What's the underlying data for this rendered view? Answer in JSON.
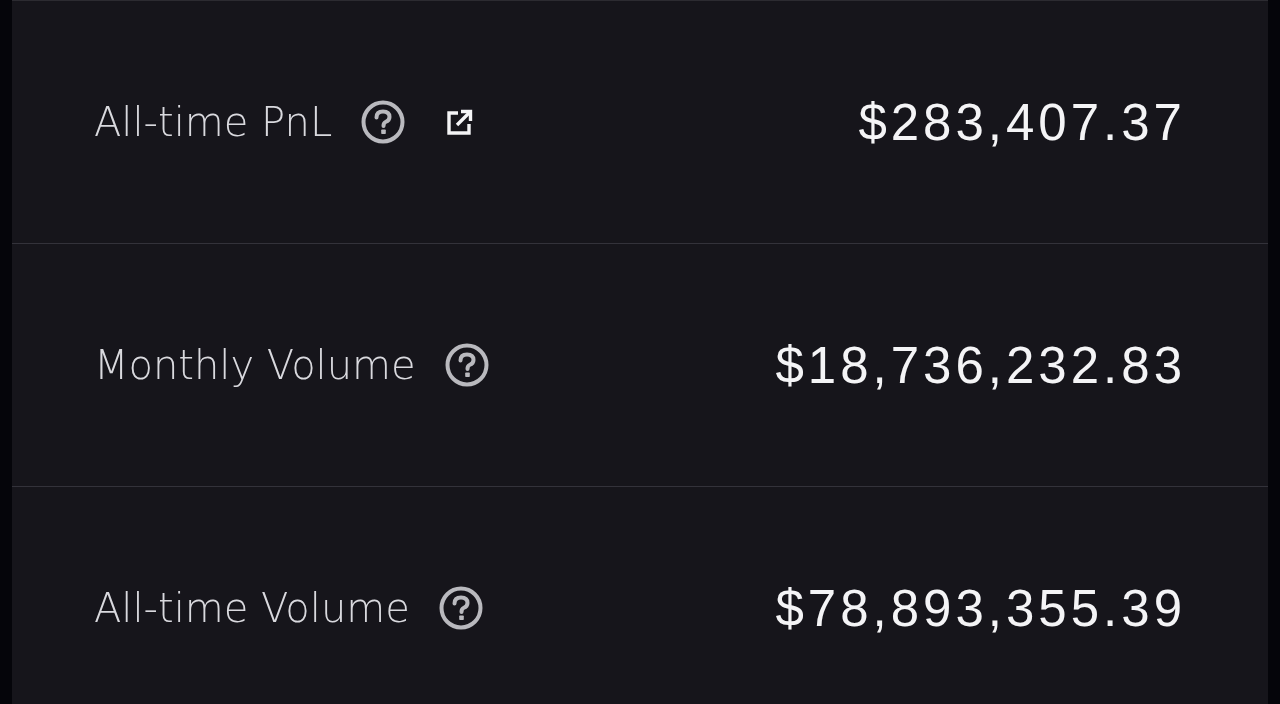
{
  "stats": [
    {
      "label": "All-time PnL",
      "value": "$283,407.37",
      "external_link": true
    },
    {
      "label": "Monthly Volume",
      "value": "$18,736,232.83",
      "external_link": false
    },
    {
      "label": "All-time Volume",
      "value": "$78,893,355.39",
      "external_link": false
    }
  ]
}
